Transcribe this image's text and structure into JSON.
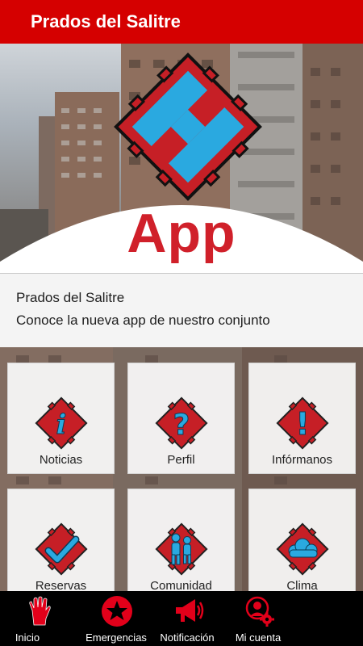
{
  "app_bar": {
    "title": "Prados del Salitre"
  },
  "hero": {
    "app_text": "App"
  },
  "info": {
    "title": "Prados del Salitre",
    "subtitle": "Conoce la nueva app de nuestro conjunto"
  },
  "tiles": [
    {
      "label": "Noticias",
      "icon": "info-icon"
    },
    {
      "label": "Perfil",
      "icon": "question-icon"
    },
    {
      "label": "Infórmanos",
      "icon": "exclamation-icon"
    },
    {
      "label": "Reservas",
      "icon": "checkmark-icon"
    },
    {
      "label": "Comunidad",
      "icon": "people-icon"
    },
    {
      "label": "Clima",
      "icon": "cloud-icon"
    }
  ],
  "bottom_nav": [
    {
      "label": "Inicio",
      "icon": "hand-icon"
    },
    {
      "label": "Emergencias",
      "icon": "star-icon"
    },
    {
      "label": "Notificación",
      "icon": "megaphone-icon"
    },
    {
      "label": "Mi cuenta",
      "icon": "user-gear-icon"
    }
  ],
  "colors": {
    "brand_red": "#d50000",
    "icon_blue": "#2aa9e0",
    "logo_red": "#d0202a"
  }
}
